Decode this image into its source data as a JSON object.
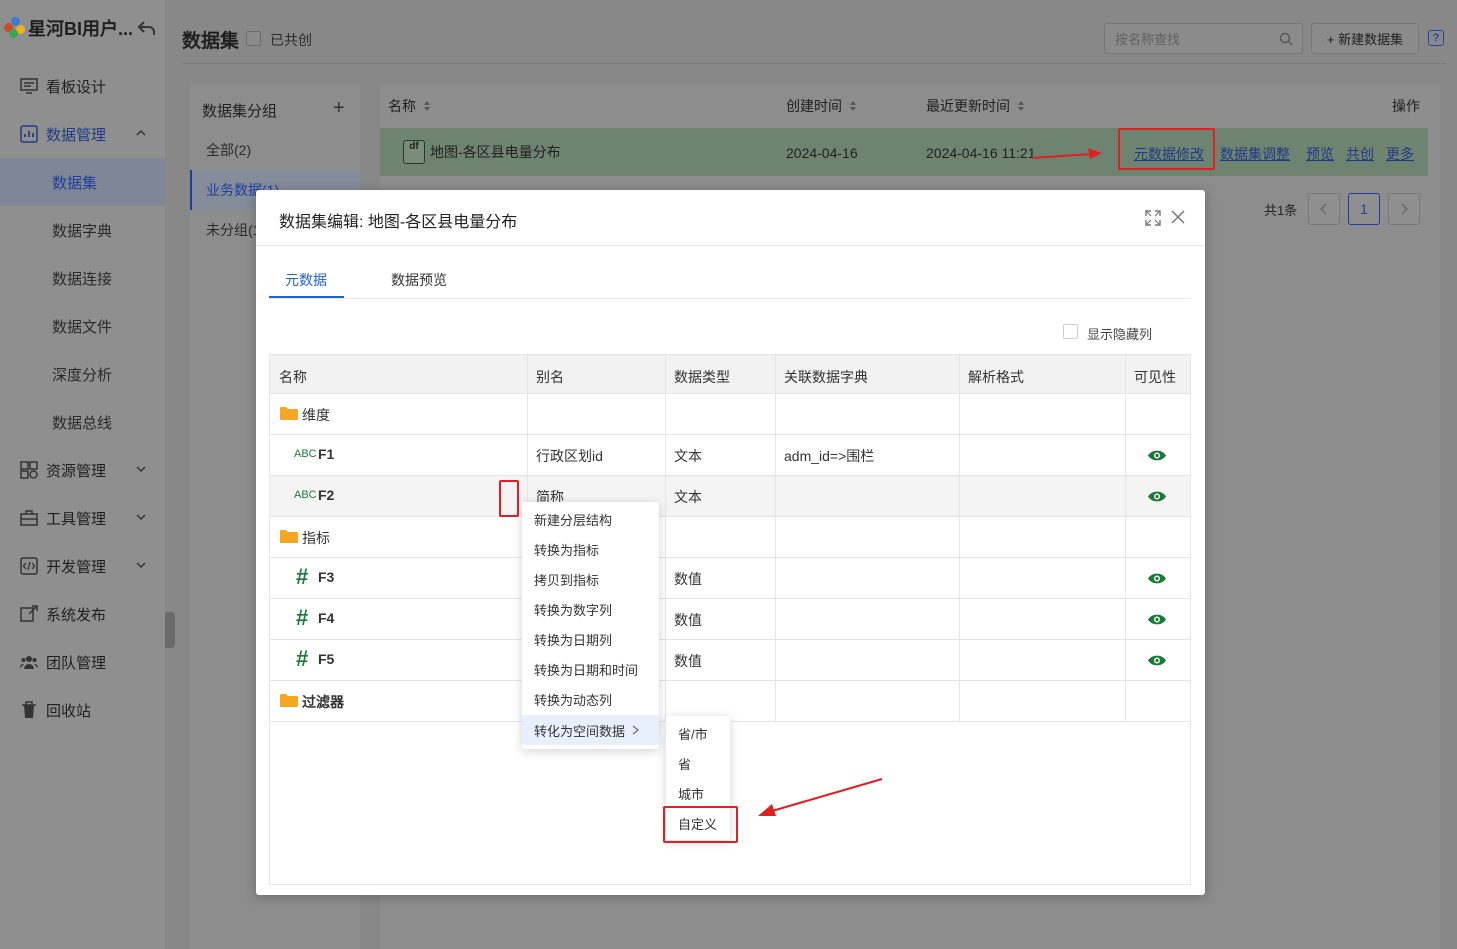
{
  "brand": {
    "title": "星河BI用户..."
  },
  "nav": {
    "items": [
      {
        "label": "看板设计"
      },
      {
        "label": "数据管理"
      },
      {
        "label": "数据集"
      },
      {
        "label": "数据字典"
      },
      {
        "label": "数据连接"
      },
      {
        "label": "数据文件"
      },
      {
        "label": "深度分析"
      },
      {
        "label": "数据总线"
      },
      {
        "label": "资源管理"
      },
      {
        "label": "工具管理"
      },
      {
        "label": "开发管理"
      },
      {
        "label": "系统发布"
      },
      {
        "label": "团队管理"
      },
      {
        "label": "回收站"
      }
    ]
  },
  "header": {
    "title": "数据集",
    "shared_label": "已共创",
    "search_placeholder": "按名称查找",
    "new_button": "+ 新建数据集"
  },
  "groups": {
    "title": "数据集分组",
    "items": [
      {
        "label": "全部(2)"
      },
      {
        "label": "业务数据(1)"
      },
      {
        "label": "未分组(1)"
      }
    ]
  },
  "table": {
    "columns": {
      "name": "名称",
      "created": "创建时间",
      "updated": "最近更新时间",
      "ops": "操作"
    },
    "row": {
      "name": "地图-各区县电量分布",
      "created": "2024-04-16",
      "updated": "2024-04-16 11:21",
      "ops": [
        "元数据修改",
        "数据集调整",
        "预览",
        "共创",
        "更多"
      ]
    }
  },
  "pager": {
    "total": "共1条",
    "current": "1"
  },
  "modal": {
    "title": "数据集编辑: 地图-各区县电量分布",
    "tabs": [
      "元数据",
      "数据预览"
    ],
    "show_hidden": "显示隐藏列",
    "columns": [
      "名称",
      "别名",
      "数据类型",
      "关联数据字典",
      "解析格式",
      "可见性"
    ],
    "rows": [
      {
        "kind": "folder",
        "name": "维度"
      },
      {
        "kind": "text",
        "name": "F1",
        "alias": "行政区划id",
        "type": "文本",
        "dict": "adm_id=>围栏"
      },
      {
        "kind": "text",
        "name": "F2",
        "alias": "简称",
        "type": "文本",
        "dict": ""
      },
      {
        "kind": "folder",
        "name": "指标"
      },
      {
        "kind": "num",
        "name": "F3",
        "alias": "",
        "type": "数值",
        "dict": ""
      },
      {
        "kind": "num",
        "name": "F4",
        "alias": "",
        "type": "数值",
        "dict": ""
      },
      {
        "kind": "num",
        "name": "F5",
        "alias": "",
        "type": "数值",
        "dict": ""
      },
      {
        "kind": "folder",
        "name": "过滤器"
      }
    ],
    "abc_label": "ABC",
    "df_label": "df"
  },
  "context_menu": {
    "items": [
      "新建分层结构",
      "转换为指标",
      "拷贝到指标",
      "转换为数字列",
      "转换为日期列",
      "转换为日期和时间",
      "转换为动态列",
      "转化为空间数据"
    ],
    "submenu": [
      "省/市",
      "省",
      "城市",
      "自定义"
    ]
  },
  "colors": {
    "accent": "#1e63d6",
    "highlight": "#e02020",
    "eye": "#1b7a3a",
    "folder": "#f5a623"
  }
}
